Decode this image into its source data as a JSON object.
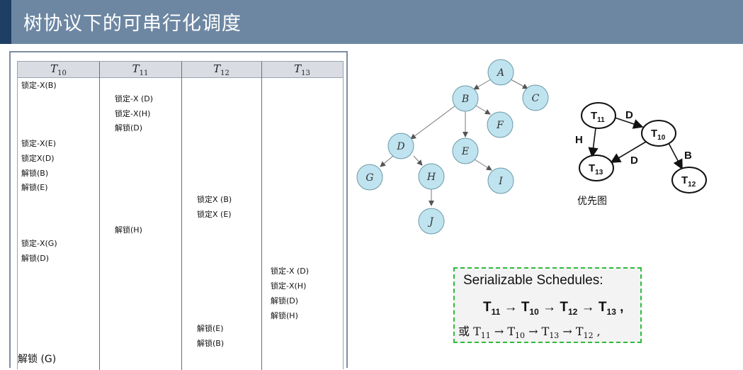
{
  "title": "树协议下的可串行化调度",
  "schedule": {
    "headers": [
      {
        "t": "T",
        "sub": "10"
      },
      {
        "t": "T",
        "sub": "11"
      },
      {
        "t": "T",
        "sub": "12"
      },
      {
        "t": "T",
        "sub": "13"
      }
    ],
    "entries": [
      "锁定-X(B)",
      "锁定-X (D)",
      "锁定-X(H)",
      "解锁(D)",
      "锁定-X(E)",
      "锁定X(D)",
      "解锁(B)",
      "解锁(E)",
      "锁定X (B)",
      "锁定X (E)",
      "解锁(H)",
      "锁定-X(G)",
      "解锁(D)",
      "锁定-X (D)",
      "锁定-X(H)",
      "解锁(D)",
      "解锁(H)",
      "解锁(E)",
      "解锁(B)",
      "解锁 (G)"
    ]
  },
  "tree": {
    "nodes": [
      "A",
      "B",
      "C",
      "D",
      "E",
      "F",
      "G",
      "H",
      "I",
      "J"
    ]
  },
  "graph": {
    "nodes": [
      {
        "t": "T",
        "sub": "11"
      },
      {
        "t": "T",
        "sub": "10"
      },
      {
        "t": "T",
        "sub": "13"
      },
      {
        "t": "T",
        "sub": "12"
      }
    ],
    "edge_labels": [
      "D",
      "H",
      "D",
      "B"
    ],
    "caption": "优先图"
  },
  "serializable": {
    "title": "Serializable Schedules:",
    "order": [
      {
        "t": "T",
        "sub": "11"
      },
      {
        "t": "T",
        "sub": "10"
      },
      {
        "t": "T",
        "sub": "12"
      },
      {
        "t": "T",
        "sub": "13"
      }
    ],
    "order_end": ",",
    "alt_prefix": "或",
    "alt_order": [
      {
        "t": "T",
        "sub": "11"
      },
      {
        "t": "T",
        "sub": "10"
      },
      {
        "t": "T",
        "sub": "13"
      },
      {
        "t": "T",
        "sub": "12"
      }
    ],
    "alt_end": ",",
    "arrow": "→"
  },
  "colors": {
    "title_bar": "#6d87a3",
    "title_accent": "#1e3f63",
    "tree_node_fill": "#bfe3ef",
    "dashed_border": "#2dbb3b"
  }
}
